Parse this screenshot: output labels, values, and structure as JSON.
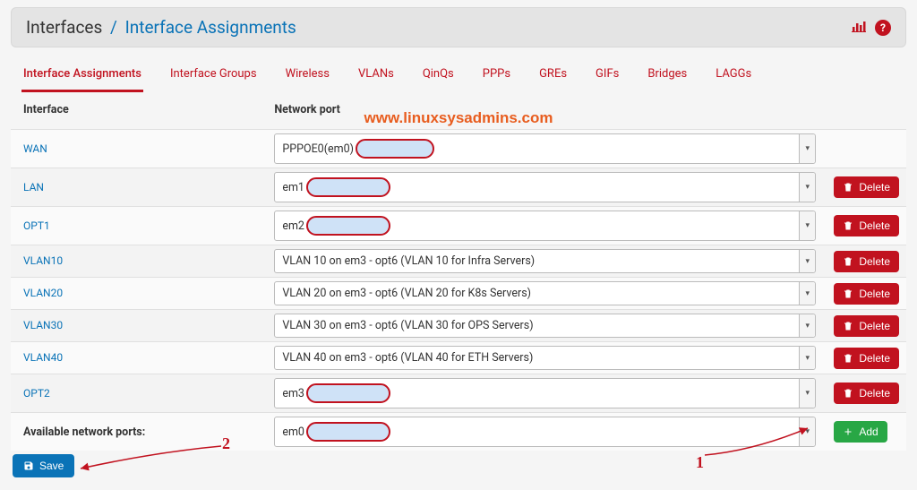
{
  "header": {
    "crumb1": "Interfaces",
    "crumb2": "Interface Assignments"
  },
  "tabs": [
    {
      "label": "Interface Assignments",
      "active": true
    },
    {
      "label": "Interface Groups",
      "active": false
    },
    {
      "label": "Wireless",
      "active": false
    },
    {
      "label": "VLANs",
      "active": false
    },
    {
      "label": "QinQs",
      "active": false
    },
    {
      "label": "PPPs",
      "active": false
    },
    {
      "label": "GREs",
      "active": false
    },
    {
      "label": "GIFs",
      "active": false
    },
    {
      "label": "Bridges",
      "active": false
    },
    {
      "label": "LAGGs",
      "active": false
    }
  ],
  "watermark": "www.linuxsysadmins.com",
  "columns": {
    "interface": "Interface",
    "port": "Network port"
  },
  "rows": [
    {
      "name": "WAN",
      "port_text": "PPPOE0(em0)",
      "blob": true,
      "deletable": false
    },
    {
      "name": "LAN",
      "port_text": "em1",
      "blob": true,
      "deletable": true
    },
    {
      "name": "OPT1",
      "port_text": "em2",
      "blob": true,
      "deletable": true
    },
    {
      "name": "VLAN10",
      "port_text": "VLAN 10 on em3 - opt6 (VLAN 10 for Infra Servers)",
      "blob": false,
      "deletable": true
    },
    {
      "name": "VLAN20",
      "port_text": "VLAN 20 on em3 - opt6 (VLAN 20 for K8s Servers)",
      "blob": false,
      "deletable": true
    },
    {
      "name": "VLAN30",
      "port_text": "VLAN 30 on em3 - opt6 (VLAN 30 for OPS Servers)",
      "blob": false,
      "deletable": true
    },
    {
      "name": "VLAN40",
      "port_text": "VLAN 40 on em3 - opt6 (VLAN 40 for ETH Servers)",
      "blob": false,
      "deletable": true
    },
    {
      "name": "OPT2",
      "port_text": "em3",
      "blob": true,
      "deletable": true
    }
  ],
  "available": {
    "label": "Available network ports:",
    "port_text": "em0"
  },
  "buttons": {
    "delete": "Delete",
    "add": "Add",
    "save": "Save"
  },
  "annotations": {
    "one": "1",
    "two": "2"
  }
}
